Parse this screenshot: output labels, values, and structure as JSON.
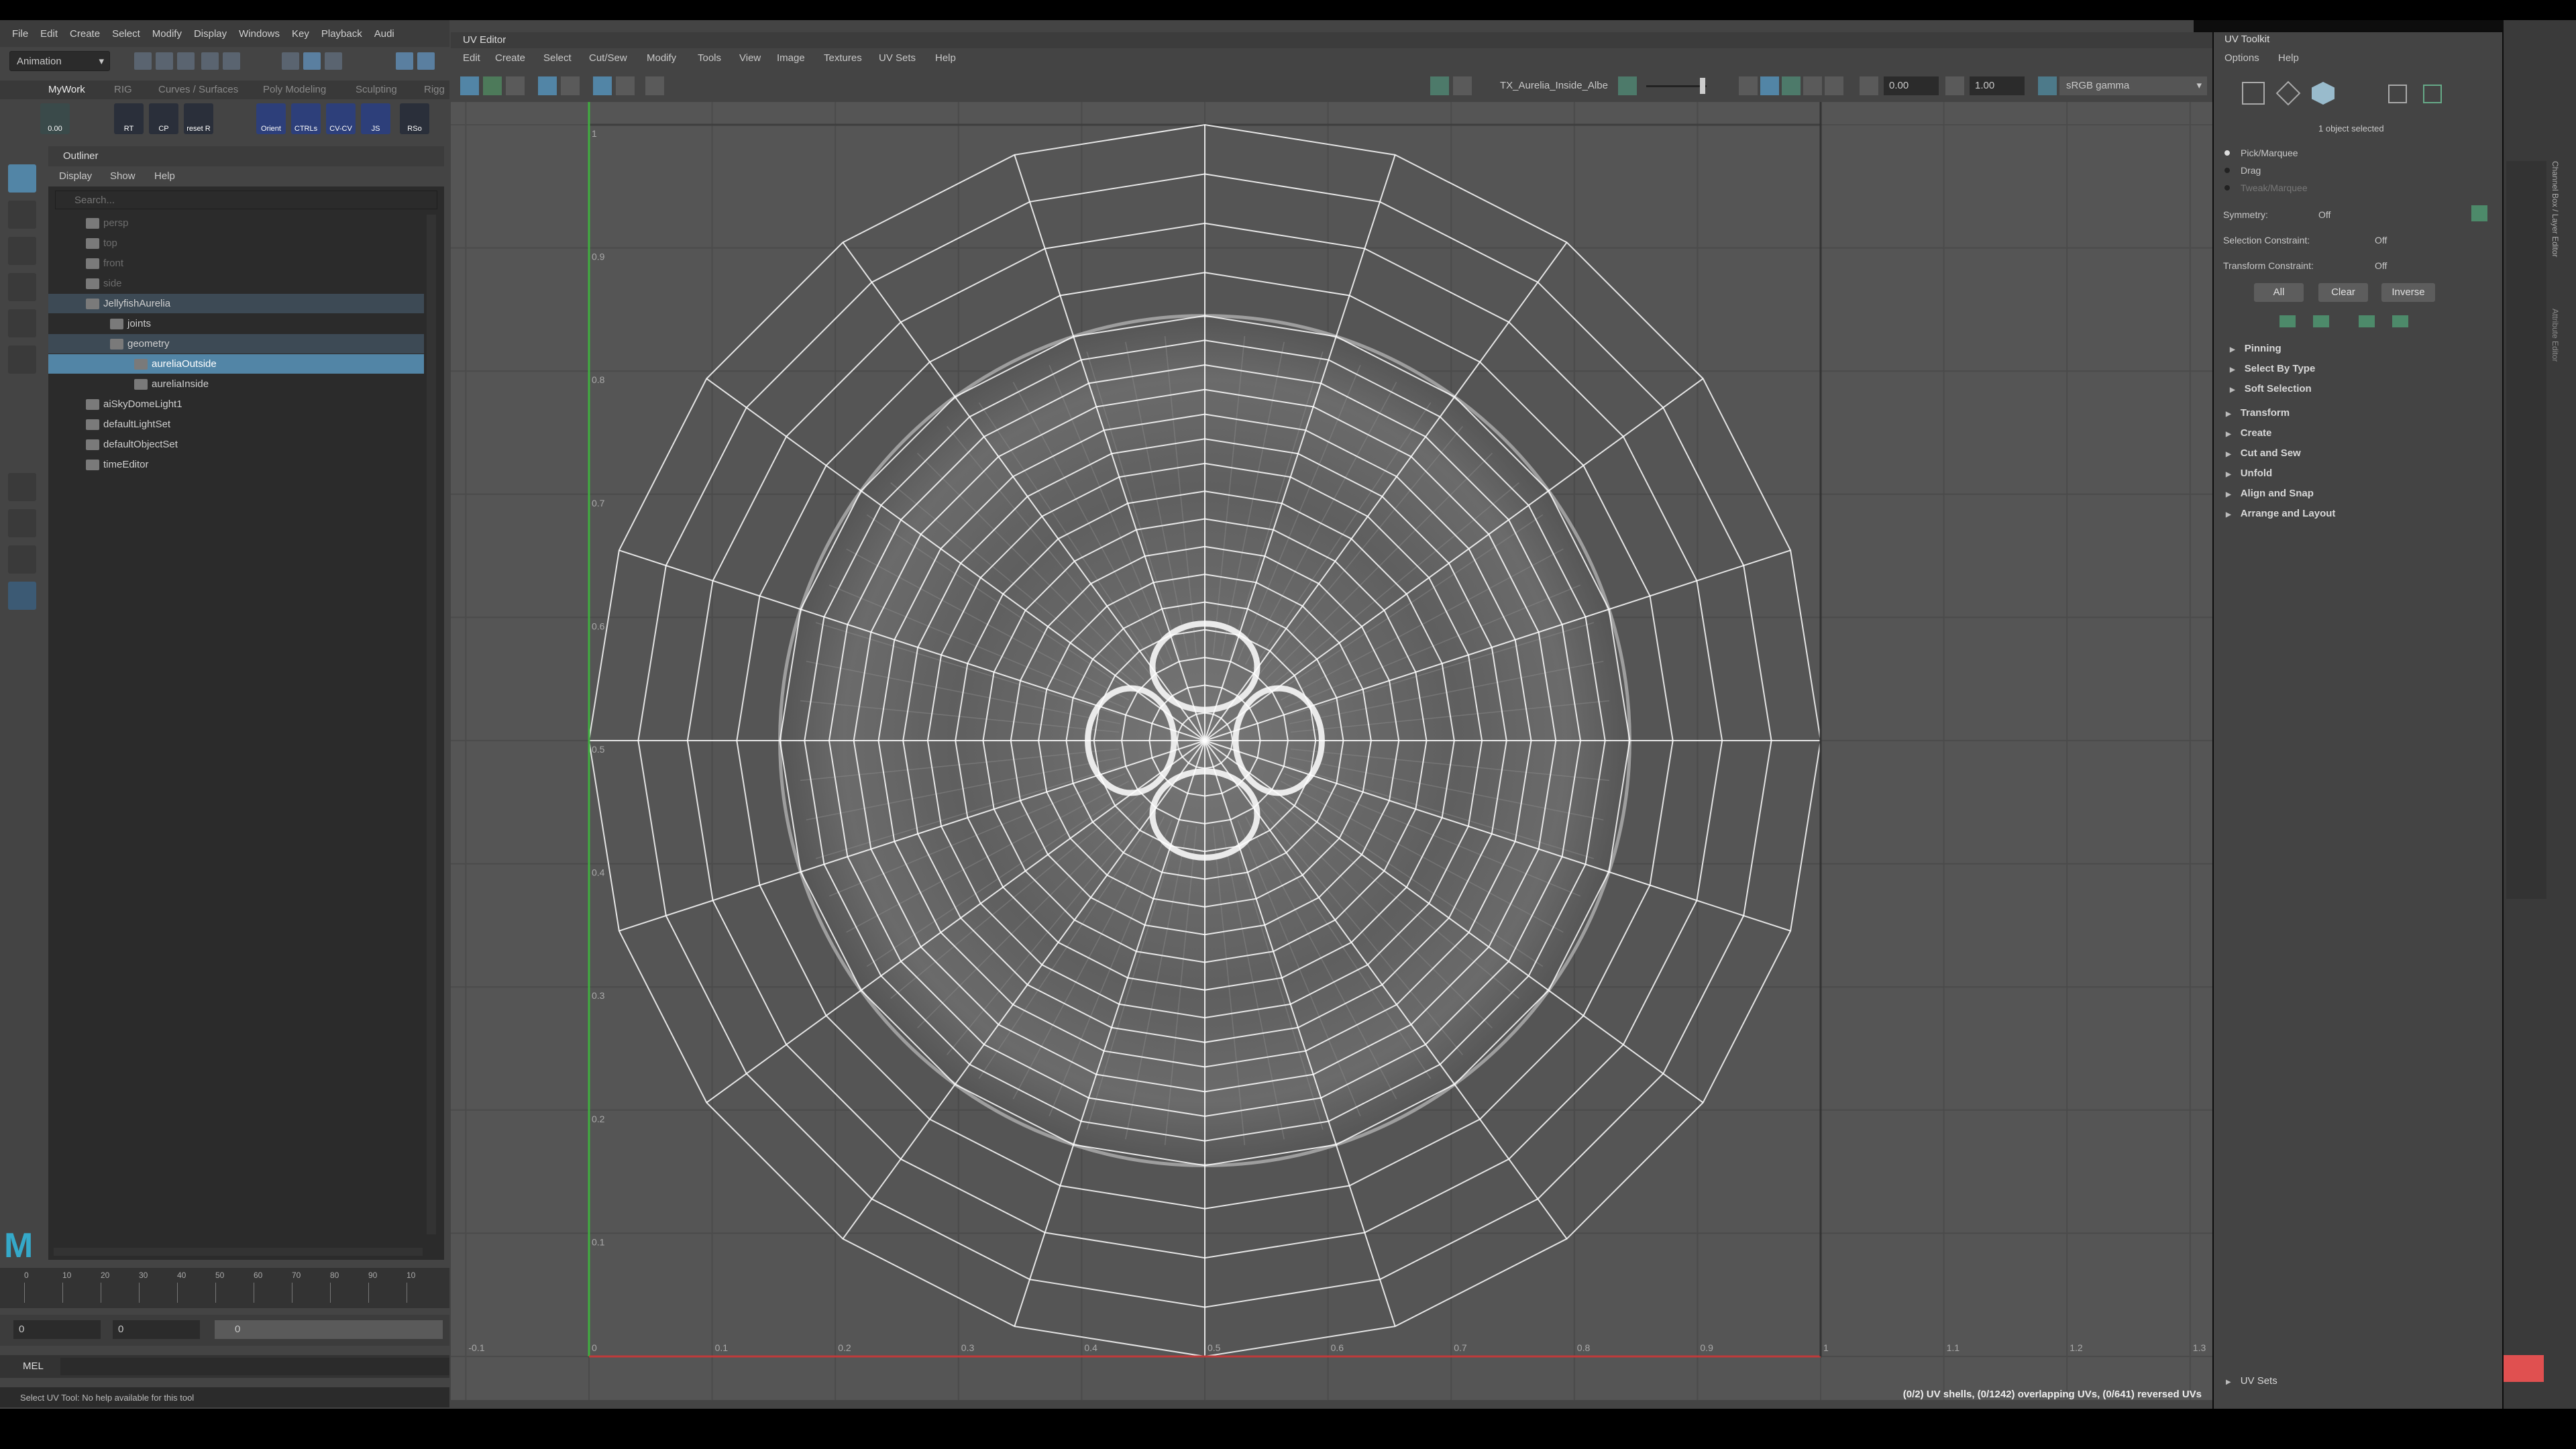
{
  "main_menu": [
    "File",
    "Edit",
    "Create",
    "Select",
    "Modify",
    "Display",
    "Windows",
    "Key",
    "Playback",
    "Audi"
  ],
  "mode_selector": "Animation",
  "shelf_tabs": [
    "MyWork",
    "RIG",
    "Curves / Surfaces",
    "Poly Modeling",
    "Sculpting",
    "Rigg"
  ],
  "shelf_buttons": [
    "RT",
    "CP",
    "reset R",
    "Orient",
    "CTRLs",
    "CV-CV",
    "JS",
    "RSo"
  ],
  "shelf_value": "0.00",
  "outliner": {
    "title": "Outliner",
    "menu": [
      "Display",
      "Show",
      "Help"
    ],
    "search_placeholder": "Search...",
    "rows": [
      {
        "label": "persp",
        "indent": 1,
        "state": "dim"
      },
      {
        "label": "top",
        "indent": 1,
        "state": "dim"
      },
      {
        "label": "front",
        "indent": 1,
        "state": "dim"
      },
      {
        "label": "side",
        "indent": 1,
        "state": "dim"
      },
      {
        "label": "JellyfishAurelia",
        "indent": 1,
        "state": "hi"
      },
      {
        "label": "joints",
        "indent": 2,
        "state": ""
      },
      {
        "label": "geometry",
        "indent": 2,
        "state": "hi"
      },
      {
        "label": "aureliaOutside",
        "indent": 3,
        "state": "sel"
      },
      {
        "label": "aureliaInside",
        "indent": 3,
        "state": ""
      },
      {
        "label": "aiSkyDomeLight1",
        "indent": 1,
        "state": ""
      },
      {
        "label": "defaultLightSet",
        "indent": 1,
        "state": ""
      },
      {
        "label": "defaultObjectSet",
        "indent": 1,
        "state": ""
      },
      {
        "label": "timeEditor",
        "indent": 1,
        "state": ""
      }
    ]
  },
  "timeline": {
    "ticks": [
      "0",
      "10",
      "20",
      "30",
      "40",
      "50",
      "60",
      "70",
      "80",
      "90",
      "10"
    ],
    "start": "0",
    "end": "0",
    "range_field": "0"
  },
  "mel_label": "MEL",
  "help_line": "Select UV Tool: No help available for this tool",
  "uv_editor": {
    "title": "UV Editor",
    "menu": [
      "Edit",
      "Create",
      "Select",
      "Cut/Sew",
      "Modify",
      "Tools",
      "View",
      "Image",
      "Textures",
      "UV Sets",
      "Help"
    ],
    "texture_name": "TX_Aurelia_Inside_Albe",
    "exposure": "0.00",
    "gamma": "1.00",
    "color_space": "sRGB gamma",
    "status": "(0/2) UV shells, (0/1242) overlapping UVs, (0/641) reversed UVs",
    "x_ticks": [
      "-0.1",
      "0",
      "0.1",
      "0.2",
      "0.3",
      "0.4",
      "0.5",
      "0.6",
      "0.7",
      "0.8",
      "0.9",
      "1",
      "1.1",
      "1.2",
      "1.3"
    ],
    "y_ticks": [
      "1",
      "0.9",
      "0.8",
      "0.7",
      "0.6",
      "0.5",
      "0.4",
      "0.3",
      "0.2",
      "0.1"
    ]
  },
  "uv_toolkit": {
    "title": "UV Toolkit",
    "menu": [
      "Options",
      "Help"
    ],
    "selected_count": "1 object selected",
    "modes": [
      "Pick/Marquee",
      "Drag",
      "Tweak/Marquee"
    ],
    "symmetry_label": "Symmetry:",
    "symmetry_value": "Off",
    "selection_constraint_label": "Selection Constraint:",
    "selection_constraint_value": "Off",
    "transform_constraint_label": "Transform Constraint:",
    "transform_constraint_value": "Off",
    "buttons": [
      "All",
      "Clear",
      "Inverse"
    ],
    "sub_sections": [
      "Pinning",
      "Select By Type",
      "Soft Selection"
    ],
    "sections": [
      "Transform",
      "Create",
      "Cut and Sew",
      "Unfold",
      "Align and Snap",
      "Arrange and Layout"
    ],
    "bottom_section": "UV Sets"
  },
  "right_panel_tabs": [
    "Channel Box / Layer Editor",
    "Attribute Editor"
  ],
  "colors": {
    "selection": "#5285a6",
    "v_axis": "#3fae3f",
    "u_axis": "#c03a3a",
    "wire": "#ffffff"
  }
}
